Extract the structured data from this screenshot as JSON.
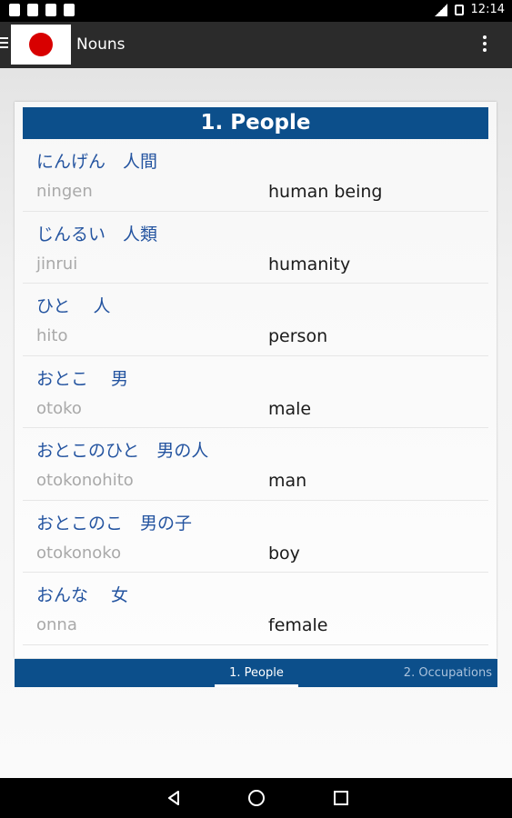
{
  "status_bar": {
    "time": "12:14"
  },
  "action_bar": {
    "title": "Nouns",
    "logo_icon": "japan-flag-logo",
    "menu_icon": "hamburger-icon",
    "overflow_icon": "more-vertical-icon"
  },
  "section": {
    "title": "1. People",
    "rows": [
      {
        "kana": "にんげん　人間",
        "romaji": "ningen",
        "english": "human being"
      },
      {
        "kana": "じんるい　人類",
        "romaji": "jinrui",
        "english": "humanity"
      },
      {
        "kana": "ひと　 人",
        "romaji": "hito",
        "english": "person"
      },
      {
        "kana": "おとこ　 男",
        "romaji": "otoko",
        "english": "male"
      },
      {
        "kana": "おとこのひと　男の人",
        "romaji": "otokonohito",
        "english": "man"
      },
      {
        "kana": "おとこのこ　男の子",
        "romaji": "otokonoko",
        "english": "boy"
      },
      {
        "kana": "おんな　 女",
        "romaji": "onna",
        "english": "female"
      }
    ]
  },
  "tabs": [
    {
      "label": "1. People"
    },
    {
      "label": "2. Occupations"
    }
  ],
  "colors": {
    "header_blue": "#0c4f8b",
    "kana_blue": "#2454a0"
  }
}
